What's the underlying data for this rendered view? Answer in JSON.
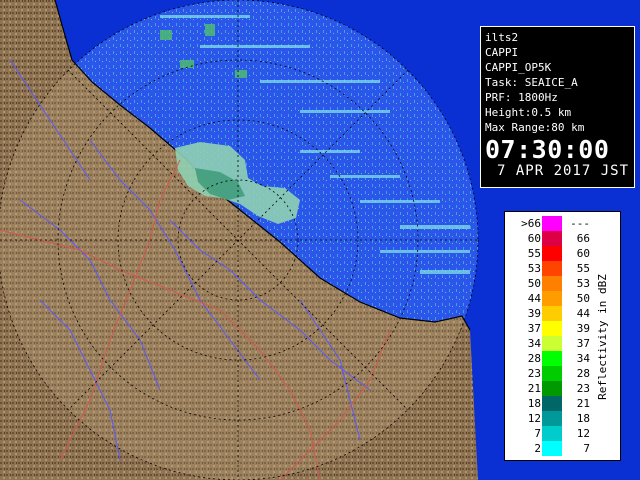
{
  "info": {
    "site": "ilts2",
    "product": "CAPPI",
    "product_detail": "CAPPI_OP5K",
    "task": "Task: SEAICE_A",
    "prf": "PRF: 1800Hz",
    "height": "Height:0.5 km",
    "max_range": "Max Range:80 km",
    "time": "07:30:00",
    "date": "7 APR 2017 JST"
  },
  "legend": {
    "title": "Reflectivity in dBZ",
    "rows": [
      {
        "lo": ">66",
        "hi": "---",
        "color": "#ff00ff"
      },
      {
        "lo": "60",
        "hi": "66",
        "color": "#dd0044"
      },
      {
        "lo": "55",
        "hi": "60",
        "color": "#ff0000"
      },
      {
        "lo": "53",
        "hi": "55",
        "color": "#ff4400"
      },
      {
        "lo": "50",
        "hi": "53",
        "color": "#ff7f00"
      },
      {
        "lo": "44",
        "hi": "50",
        "color": "#ff9c00"
      },
      {
        "lo": "39",
        "hi": "44",
        "color": "#ffcc00"
      },
      {
        "lo": "37",
        "hi": "39",
        "color": "#ffff00"
      },
      {
        "lo": "34",
        "hi": "37",
        "color": "#ccff33"
      },
      {
        "lo": "28",
        "hi": "34",
        "color": "#00ff00"
      },
      {
        "lo": "23",
        "hi": "28",
        "color": "#00cc00"
      },
      {
        "lo": "21",
        "hi": "23",
        "color": "#009900"
      },
      {
        "lo": "18",
        "hi": "21",
        "color": "#006666"
      },
      {
        "lo": "12",
        "hi": "18",
        "color": "#009999"
      },
      {
        "lo": "7",
        "hi": "12",
        "color": "#00cccc"
      },
      {
        "lo": "2",
        "hi": "7",
        "color": "#00ffff"
      }
    ]
  },
  "colors": {
    "ocean": "#0a2fd2",
    "radar_range": "#2c56ea",
    "land": "#8e7452",
    "rivers": "#5a5aff",
    "borders": "#d05a50"
  }
}
